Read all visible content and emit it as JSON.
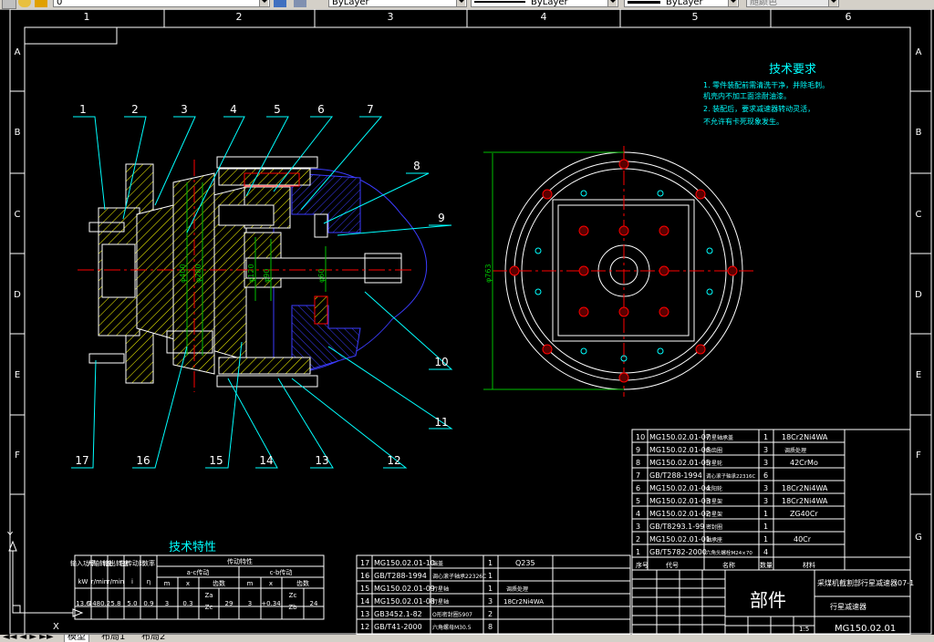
{
  "toolbar": {
    "layer_value": "0",
    "linetype_value": "ByLayer",
    "lineweight_value": "ByLayer",
    "plotstyle_value": "ByLayer",
    "color_value": "随颜色"
  },
  "drawing": {
    "col_labels": [
      "1",
      "2",
      "3",
      "4",
      "5",
      "6"
    ],
    "row_labels": [
      "A",
      "B",
      "C",
      "D",
      "E",
      "F",
      "G"
    ],
    "balloons": [
      "1",
      "2",
      "3",
      "4",
      "5",
      "6",
      "7",
      "8",
      "9",
      "10",
      "11",
      "12",
      "13",
      "14",
      "15",
      "16",
      "17"
    ],
    "dim_labels": {
      "d1": "φ400",
      "d2": "φ280",
      "d3": "φ120",
      "d4": "φ90",
      "d5": "φ60",
      "d6": "φ763"
    }
  },
  "tech_requirements": {
    "title": "技术要求",
    "lines": [
      "1. 零件装配前需清洗干净，并除毛刺。",
      "机壳内不加工面涂耐油漆。",
      "2. 装配后，要求减速器转动灵活，",
      "不允许有卡死现象发生。"
    ]
  },
  "tech_specs": {
    "title": "技术特性",
    "headers": {
      "c1": "输入功率",
      "c2": "入轴转速",
      "c3": "输出转速",
      "c4": "总传动比",
      "c5": "效率",
      "group": "传动特性",
      "sub1": "a-c传动",
      "sub2": "c-b传动",
      "m": "m",
      "x": "x",
      "teeth": "齿数",
      "za": "Za",
      "zc": "Zc",
      "zb": "Zb",
      "units": [
        "kW",
        "r/min",
        "r/min",
        "i",
        "η"
      ]
    },
    "row": [
      "13.6",
      "1480.2",
      "5.8",
      "5.0",
      "0.9",
      "3",
      "0.3",
      "29",
      "3",
      "+0.34",
      "24"
    ]
  },
  "bom_upper": [
    {
      "no": "10",
      "code": "MG150.02.01-07",
      "name": "行星轴承盖",
      "qty": "1",
      "material": "18Cr2Ni4WA"
    },
    {
      "no": "9",
      "code": "MG150.02.01-06",
      "name": "内齿圈",
      "qty": "3",
      "material": "调质处理"
    },
    {
      "no": "8",
      "code": "MG150.02.01-05",
      "name": "行星轮",
      "qty": "3",
      "material": "42CrMo"
    },
    {
      "no": "7",
      "code": "GB/T288-1994",
      "name": "调心滚子轴承22316C",
      "qty": "6",
      "material": ""
    },
    {
      "no": "6",
      "code": "MG150.02.01-04",
      "name": "太阳轮",
      "qty": "3",
      "material": "18Cr2Ni4WA"
    },
    {
      "no": "5",
      "code": "MG150.02.01-03",
      "name": "行星架",
      "qty": "3",
      "material": "18Cr2Ni4WA"
    },
    {
      "no": "4",
      "code": "MG150.02.01-02",
      "name": "行星架",
      "qty": "1",
      "material": "ZG40Cr"
    },
    {
      "no": "3",
      "code": "GB/T8293.1-99",
      "name": "密封圈",
      "qty": "1",
      "material": ""
    },
    {
      "no": "2",
      "code": "MG150.02.01-01",
      "name": "轴承座",
      "qty": "1",
      "material": "40Cr"
    },
    {
      "no": "1",
      "code": "GB/T5782-2000",
      "name": "六角头螺栓M24×70",
      "qty": "4",
      "material": ""
    }
  ],
  "bom_upper_header": {
    "no": "序号",
    "code": "代号",
    "name": "名称",
    "qty": "数量",
    "material": "材料"
  },
  "bom_lower": [
    {
      "no": "17",
      "code": "MG150.02.01-10",
      "name": "端盖",
      "qty": "1",
      "material": "Q235"
    },
    {
      "no": "16",
      "code": "GB/T288-1994",
      "name": "调心滚子轴承22326C",
      "qty": "1",
      "material": ""
    },
    {
      "no": "15",
      "code": "MG150.02.01-09",
      "name": "行星轴",
      "qty": "1",
      "material": "调质处理"
    },
    {
      "no": "14",
      "code": "MG150.02.01-08",
      "name": "行星轴",
      "qty": "3",
      "material": "18Cr2Ni4WA"
    },
    {
      "no": "13",
      "code": "GB3452.1-82",
      "name": "O形密封圈5907",
      "qty": "2",
      "material": ""
    },
    {
      "no": "12",
      "code": "GB/T41-2000",
      "name": "六角螺母M30.5",
      "qty": "8",
      "material": ""
    }
  ],
  "title_block": {
    "part_word": "部件",
    "project": "采煤机截割部行星减速器07-1",
    "subtitle": "行星减速器",
    "drawing_no": "MG150.02.01",
    "scale_label": "1:5"
  },
  "ucs": {
    "x": "X",
    "y": "Y"
  },
  "tabs": [
    "模型",
    "布局1",
    "布局2"
  ],
  "colors": {
    "cyan": "#00ffff",
    "white": "#ffffff",
    "yellow": "#ffff00",
    "red": "#ff0000",
    "blue": "#3c3cff",
    "green": "#00c000"
  }
}
